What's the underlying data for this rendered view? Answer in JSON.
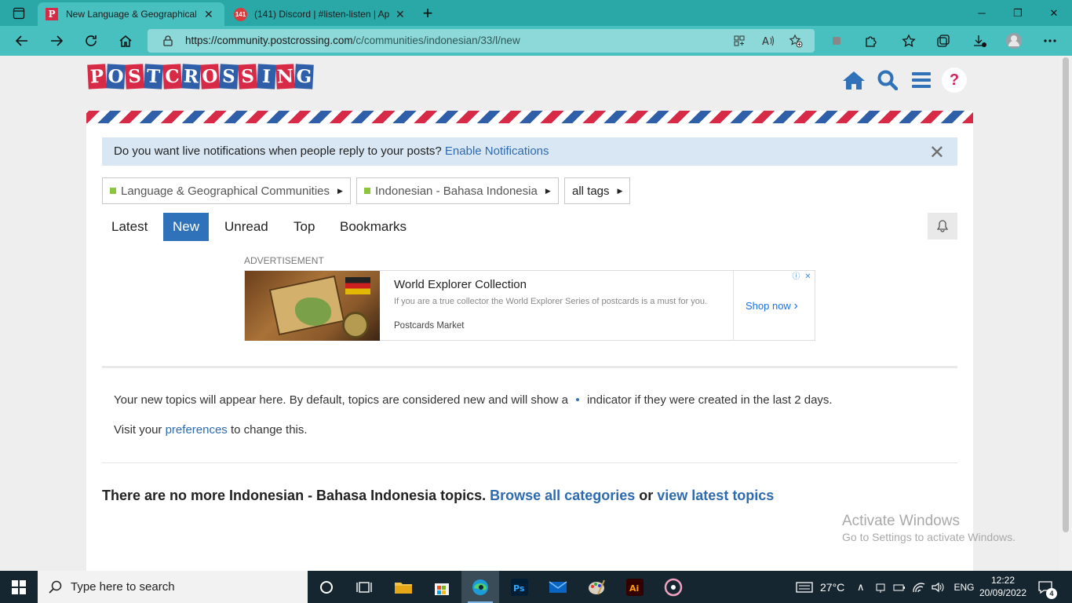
{
  "browser": {
    "tabs": [
      {
        "title": "New Language & Geographical C",
        "favicon": "P",
        "active": true
      },
      {
        "title": "(141) Discord | #listen-listen | Ap",
        "favicon": "141",
        "active": false
      }
    ],
    "new_tab_label": "+",
    "url_host": "https://community.postcrossing.com",
    "url_path": "/c/communities/indonesian/33/l/new",
    "window_controls": {
      "minimize": "─",
      "restore": "❐",
      "close": "✕"
    }
  },
  "site": {
    "logo_letters": [
      "P",
      "O",
      "S",
      "T",
      "C",
      "R",
      "O",
      "S",
      "S",
      "I",
      "N",
      "G"
    ],
    "help_label": "?",
    "notice": {
      "text": "Do you want live notifications when people reply to your posts?",
      "link": "Enable Notifications",
      "close": "✕"
    },
    "breadcrumbs": [
      {
        "label": "Language & Geographical Communities",
        "has_square": true
      },
      {
        "label": "Indonesian - Bahasa Indonesia",
        "has_square": true
      },
      {
        "label": "all tags",
        "has_square": false
      }
    ],
    "nav_tabs": [
      {
        "label": "Latest",
        "active": false
      },
      {
        "label": "New",
        "active": true
      },
      {
        "label": "Unread",
        "active": false
      },
      {
        "label": "Top",
        "active": false
      },
      {
        "label": "Bookmarks",
        "active": false
      }
    ],
    "ad": {
      "label": "ADVERTISEMENT",
      "title": "World Explorer Collection",
      "description": "If you are a true collector the World Explorer Series of postcards is a must for you.",
      "source": "Postcards Market",
      "cta": "Shop now",
      "info_icons": [
        "ⓘ",
        "✕"
      ]
    },
    "empty_state": {
      "line1_before": "Your new topics will appear here. By default, topics are considered new and will show a",
      "line1_after": "indicator if they were created in the last 2 days.",
      "line2_before": "Visit your",
      "line2_link": "preferences",
      "line2_after": "to change this."
    },
    "footer_message": {
      "text": "There are no more Indonesian - Bahasa Indonesia topics.",
      "link1": "Browse all categories",
      "conj": "or",
      "link2": "view latest topics"
    }
  },
  "watermark": {
    "line1": "Activate Windows",
    "line2": "Go to Settings to activate Windows."
  },
  "taskbar": {
    "search_placeholder": "Type here to search",
    "weather": "27°C",
    "language": "ENG",
    "time": "12:22",
    "date": "20/09/2022",
    "notifications": "4"
  },
  "colors": {
    "brand_red": "#d72a46",
    "brand_blue": "#2f5fa8",
    "accent_blue": "#2f72b9",
    "tab_teal": "#2aa7a7"
  }
}
